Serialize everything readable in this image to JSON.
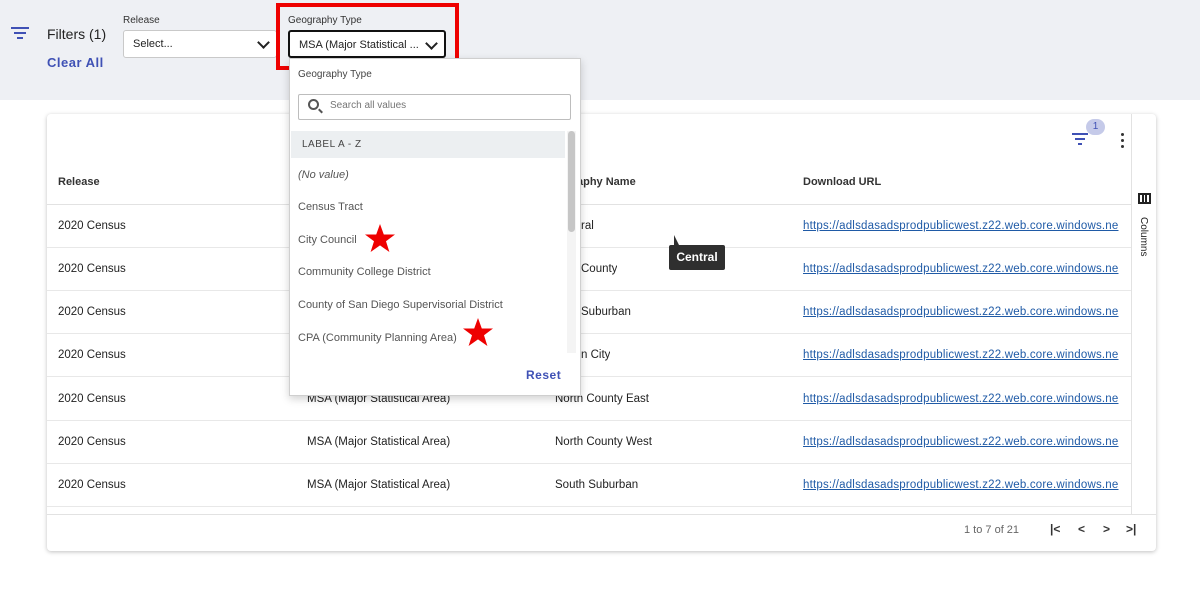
{
  "filters": {
    "label": "Filters (1)",
    "clear_all": "Clear All",
    "release": {
      "label": "Release",
      "value": "Select..."
    },
    "geography_type": {
      "label": "Geography Type",
      "value": "MSA (Major Statistical ..."
    }
  },
  "annotation_color": "#ee0000",
  "dropdown": {
    "title": "Geography Type",
    "search_placeholder": "Search all values",
    "sort_label": "LABEL A - Z",
    "items": [
      "(No value)",
      "Census Tract",
      "City Council",
      "Community College District",
      "County of San Diego Supervisorial District",
      "CPA (Community Planning Area)"
    ],
    "starred_items": [
      "City Council",
      "CPA (Community Planning Area)"
    ],
    "reset": "Reset"
  },
  "grid": {
    "filter_badge": "1",
    "columns_panel_label": "Columns",
    "headers": [
      "Release",
      "",
      "graphy Name",
      "Download URL"
    ],
    "rows": [
      [
        "2020 Census",
        "",
        "ral",
        "https://adlsdasadsprodpublicwest.z22.web.core.windows.ne"
      ],
      [
        "2020 Census",
        "",
        "County",
        "https://adlsdasadsprodpublicwest.z22.web.core.windows.ne"
      ],
      [
        "2020 Census",
        "",
        "Suburban",
        "https://adlsdasadsprodpublicwest.z22.web.core.windows.ne"
      ],
      [
        "2020 Census",
        "",
        "n City",
        "https://adlsdasadsprodpublicwest.z22.web.core.windows.ne"
      ],
      [
        "2020 Census",
        "MSA (Major Statistical Area)",
        "North County East",
        "https://adlsdasadsprodpublicwest.z22.web.core.windows.ne"
      ],
      [
        "2020 Census",
        "MSA (Major Statistical Area)",
        "North County West",
        "https://adlsdasadsprodpublicwest.z22.web.core.windows.ne"
      ],
      [
        "2020 Census",
        "MSA (Major Statistical Area)",
        "South Suburban",
        "https://adlsdasadsprodpublicwest.z22.web.core.windows.ne"
      ]
    ],
    "tooltip": "Central",
    "pagination": {
      "summary": "1 to 7 of 21",
      "first": "|<",
      "prev": "<",
      "next": ">",
      "last": ">|"
    }
  }
}
